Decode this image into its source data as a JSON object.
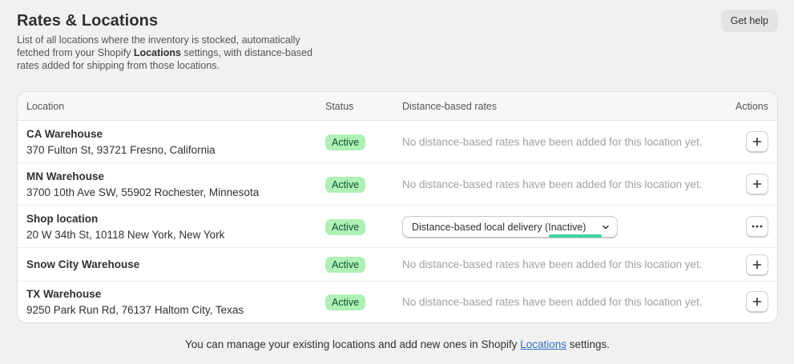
{
  "header": {
    "title": "Rates & Locations",
    "desc_before": "List of all locations where the inventory is stocked, automatically fetched from your Shopify ",
    "desc_bold": "Locations",
    "desc_after": " settings, with distance-based rates added for shipping from those locations.",
    "help_label": "Get help"
  },
  "table": {
    "columns": {
      "location": "Location",
      "status": "Status",
      "rates": "Distance-based rates",
      "actions": "Actions"
    },
    "empty_text": "No distance-based rates have been added for this location yet.",
    "rows": [
      {
        "name": "CA Warehouse",
        "address": "370 Fulton St, 93721 Fresno, California",
        "status": "Active"
      },
      {
        "name": "MN Warehouse",
        "address": "3700 10th Ave SW, 55902 Rochester, Minnesota",
        "status": "Active"
      },
      {
        "name": "Shop location",
        "address": "20 W 34th St, 10118 New York, New York",
        "status": "Active",
        "rate_label": "Distance-based local delivery (Inactive)"
      },
      {
        "name": "Snow City Warehouse",
        "address": "",
        "status": "Active"
      },
      {
        "name": "TX Warehouse",
        "address": "9250 Park Run Rd, 76137 Haltom City, Texas",
        "status": "Active"
      }
    ]
  },
  "footer": {
    "before": "You can manage your existing locations and add new ones in Shopify ",
    "link": "Locations",
    "after": " settings."
  },
  "colors": {
    "badge_bg": "#aff0b5",
    "badge_text": "#0c5132",
    "link": "#2c6ecb",
    "highlight": "#3dd6a3"
  },
  "icons": {
    "add": "plus-icon",
    "more": "more-horizontal-icon",
    "dropdown": "chevron-down-icon"
  }
}
